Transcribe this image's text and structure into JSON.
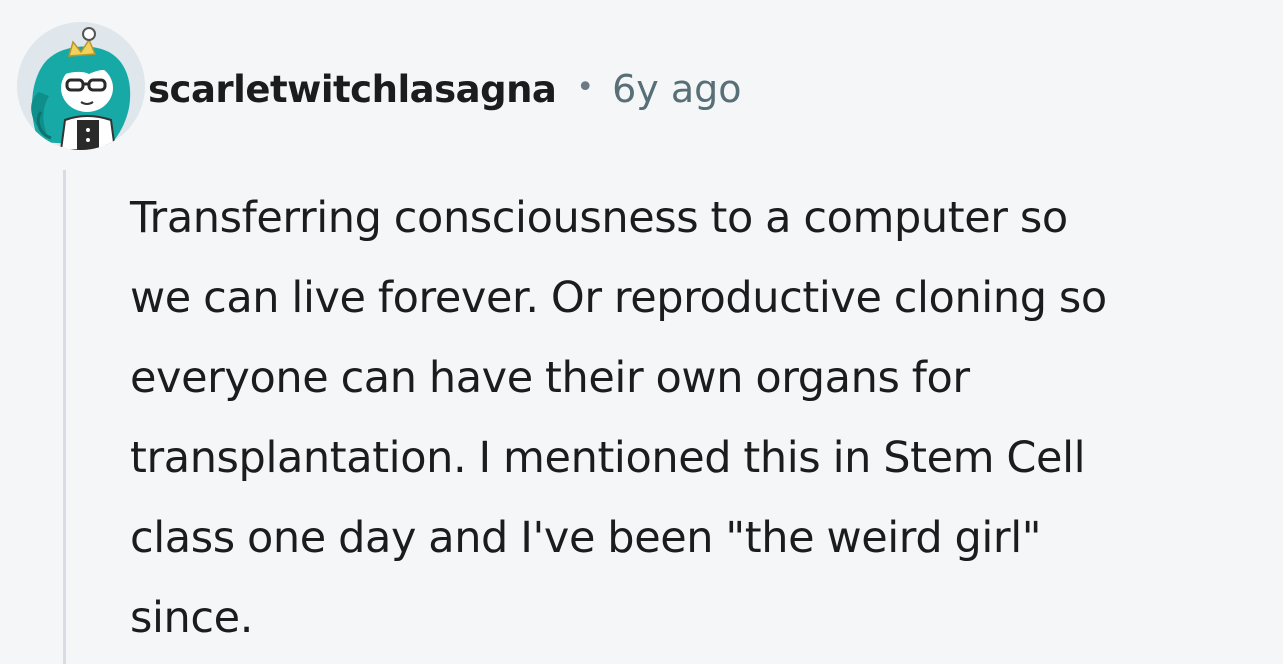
{
  "comment": {
    "username": "scarletwitchlasagna",
    "separator": "•",
    "timestamp": "6y ago",
    "body_lines": [
      "Transferring consciousness to a computer so",
      "we can live forever. Or reproductive cloning so",
      "everyone can have their own organs for",
      "transplantation. I mentioned this in Stem Cell",
      "class one day and I've been \"the weird girl\"",
      "since."
    ]
  },
  "colors": {
    "background": "#f5f6f8",
    "text": "#1c1c1c",
    "meta": "#576f76",
    "thread_line": "#d7dde2",
    "avatar_teal": "#17a9a6"
  }
}
